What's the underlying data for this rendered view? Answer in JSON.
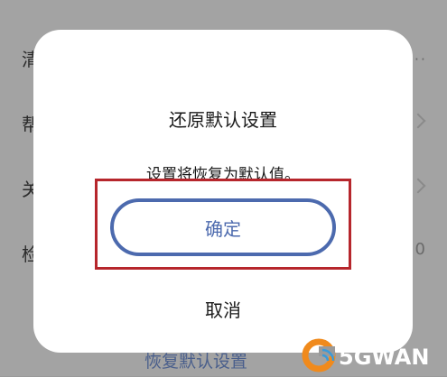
{
  "background_list": {
    "items": [
      {
        "label": "清"
      },
      {
        "label": "帮"
      },
      {
        "label": "关"
      },
      {
        "label": "检"
      }
    ],
    "value_text": "0",
    "footer_link": "恢复默认设置"
  },
  "dialog": {
    "title": "还原默认设置",
    "message": "设置将恢复为默认值。",
    "confirm_label": "确定",
    "cancel_label": "取消"
  },
  "watermark": {
    "text": "5GWAN"
  },
  "colors": {
    "accent": "#4c6aae",
    "highlight": "#b6262c",
    "watermark_orange": "#f08a1c",
    "watermark_blue": "#3a9ad9"
  }
}
